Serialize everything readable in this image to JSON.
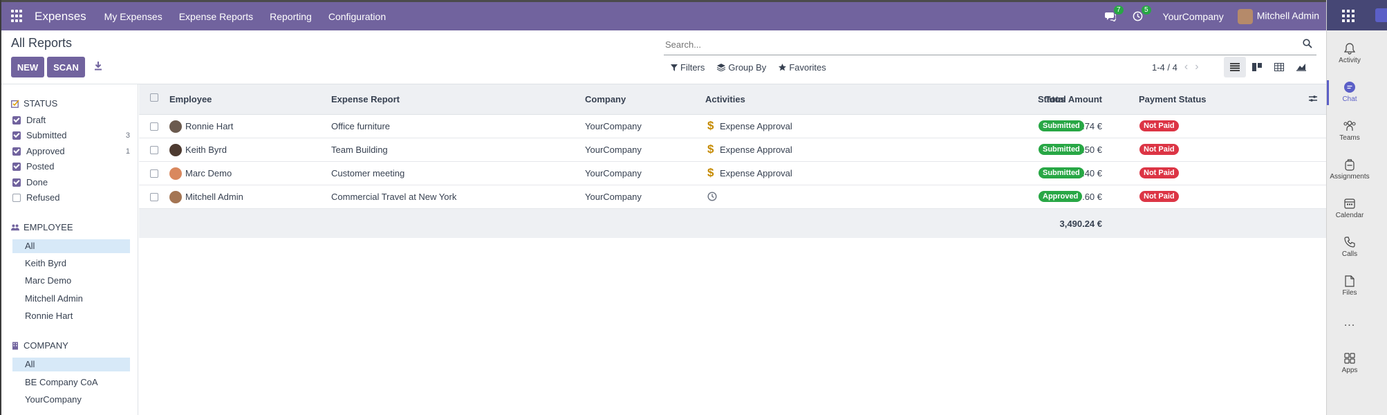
{
  "navbar": {
    "app_name": "Expenses",
    "menu": [
      "My Expenses",
      "Expense Reports",
      "Reporting",
      "Configuration"
    ],
    "chat_count": "7",
    "activity_count": "5",
    "company": "YourCompany",
    "user": "Mitchell Admin",
    "accent": "#71639e"
  },
  "control_panel": {
    "breadcrumb": "All Reports",
    "new_label": "NEW",
    "scan_label": "SCAN",
    "search_placeholder": "Search...",
    "filters_label": "Filters",
    "group_by_label": "Group By",
    "favorites_label": "Favorites",
    "pager": "1-4 / 4"
  },
  "sidebar": {
    "status": {
      "title": "STATUS",
      "items": [
        {
          "label": "Draft",
          "checked": true,
          "count": ""
        },
        {
          "label": "Submitted",
          "checked": true,
          "count": "3"
        },
        {
          "label": "Approved",
          "checked": true,
          "count": "1"
        },
        {
          "label": "Posted",
          "checked": true,
          "count": ""
        },
        {
          "label": "Done",
          "checked": true,
          "count": ""
        },
        {
          "label": "Refused",
          "checked": false,
          "count": ""
        }
      ]
    },
    "employee": {
      "title": "EMPLOYEE",
      "items": [
        "All",
        "Keith Byrd",
        "Marc Demo",
        "Mitchell Admin",
        "Ronnie Hart"
      ]
    },
    "company": {
      "title": "COMPANY",
      "items": [
        "All",
        "BE Company CoA",
        "YourCompany"
      ]
    }
  },
  "table": {
    "headers": [
      "Employee",
      "Expense Report",
      "Company",
      "Activities",
      "Total Amount",
      "Status",
      "Payment Status"
    ],
    "rows": [
      {
        "employee": "Ronnie Hart",
        "report": "Office furniture",
        "company": "YourCompany",
        "activity": "Expense Approval",
        "amount": "84.74 €",
        "status": "Submitted",
        "payment": "Not Paid"
      },
      {
        "employee": "Keith Byrd",
        "report": "Team Building",
        "company": "YourCompany",
        "activity": "Expense Approval",
        "amount": "221.50 €",
        "status": "Submitted",
        "payment": "Not Paid"
      },
      {
        "employee": "Marc Demo",
        "report": "Customer meeting",
        "company": "YourCompany",
        "activity": "Expense Approval",
        "amount": "274.40 €",
        "status": "Submitted",
        "payment": "Not Paid"
      },
      {
        "employee": "Mitchell Admin",
        "report": "Commercial Travel at New York",
        "company": "YourCompany",
        "activity": "",
        "amount": "2,909.60 €",
        "status": "Approved",
        "payment": "Not Paid"
      }
    ],
    "total": "3,490.24 €",
    "status_colors": {
      "submitted": "#28a745",
      "approved": "#28a745",
      "not_paid": "#dc3545"
    }
  },
  "teams": {
    "items": [
      "Activity",
      "Chat",
      "Teams",
      "Assignments",
      "Calendar",
      "Calls",
      "Files",
      "Apps"
    ],
    "more": "..."
  }
}
